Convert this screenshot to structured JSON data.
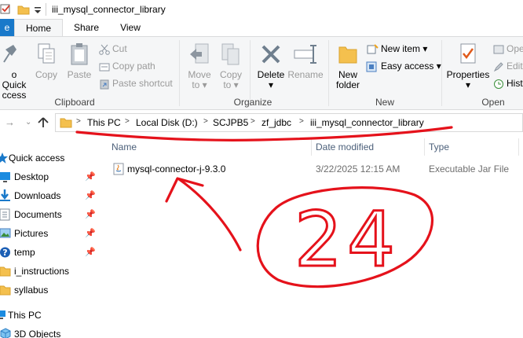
{
  "window": {
    "title": "iii_mysql_connector_library"
  },
  "ribbon_tabs": {
    "file": "e",
    "home": "Home",
    "share": "Share",
    "view": "View"
  },
  "clipboard": {
    "pin_label_1": "o Quick",
    "pin_label_2": "ccess",
    "copy": "Copy",
    "paste": "Paste",
    "cut": "Cut",
    "copy_path": "Copy path",
    "paste_shortcut": "Paste shortcut",
    "group": "Clipboard"
  },
  "organize": {
    "move_to_1": "Move",
    "move_to_2": "to",
    "copy_to_1": "Copy",
    "copy_to_2": "to",
    "delete": "Delete",
    "rename": "Rename",
    "group": "Organize"
  },
  "new": {
    "new_folder_1": "New",
    "new_folder_2": "folder",
    "new_item": "New item",
    "easy_access": "Easy access",
    "group": "New"
  },
  "open": {
    "properties": "Properties",
    "open": "Ope",
    "edit": "Edit",
    "history": "Hist",
    "group": "Open"
  },
  "address": {
    "crumbs": [
      "This PC",
      "Local Disk (D:)",
      "SCJPB5",
      "zf_jdbc",
      "iii_mysql_connector_library"
    ]
  },
  "nav": {
    "items": [
      {
        "label": "Quick access",
        "icon": "star-icon"
      },
      {
        "label": "Desktop",
        "icon": "desktop-icon"
      },
      {
        "label": "Downloads",
        "icon": "download-icon"
      },
      {
        "label": "Documents",
        "icon": "documents-icon"
      },
      {
        "label": "Pictures",
        "icon": "pictures-icon"
      },
      {
        "label": "temp",
        "icon": "help-icon"
      },
      {
        "label": "i_instructions",
        "icon": "folder-icon"
      },
      {
        "label": "syllabus",
        "icon": "folder-icon"
      },
      {
        "label": "This PC",
        "icon": "computer-icon"
      },
      {
        "label": "3D Objects",
        "icon": "cube-icon"
      }
    ]
  },
  "columns": {
    "name": "Name",
    "date": "Date modified",
    "type": "Type"
  },
  "files": [
    {
      "name": "mysql-connector-j-9.3.0",
      "date": "3/22/2025 12:15 AM",
      "type": "Executable Jar File",
      "icon": "java-jar-icon"
    }
  ],
  "annotation": {
    "text": "24",
    "color": "#e5121b"
  },
  "colors": {
    "accent": "#1979ca",
    "folder": "#f4c04e",
    "annotation": "#e5121b"
  }
}
